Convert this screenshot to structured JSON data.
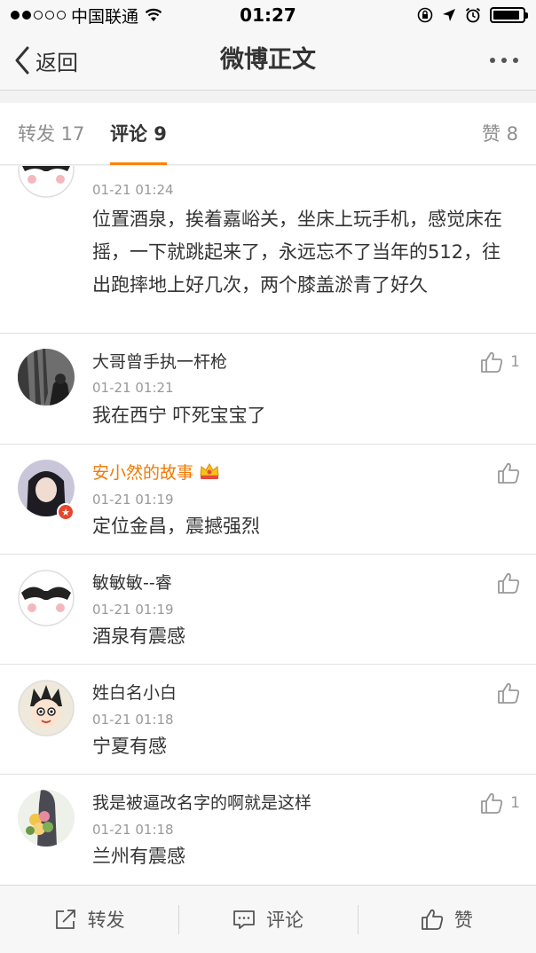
{
  "status_bar": {
    "carrier": "中国联通",
    "time": "01:27",
    "signal_filled": 2,
    "signal_total": 5,
    "battery_level": 0.9
  },
  "navbar": {
    "back_label": "返回",
    "title": "微博正文"
  },
  "tabs": {
    "repost": "转发 17",
    "comment": "评论 9",
    "like": "赞 8",
    "active": "comment",
    "accent": "#ff8200"
  },
  "comments": [
    {
      "name": "",
      "time": "01-21 01:24",
      "text": "位置酒泉，挨着嘉峪关，坐床上玩手机，感觉床在摇，一下就跳起来了，永远忘不了当年的512，往出跑摔地上好几次，两个膝盖淤青了好久",
      "likes": "",
      "avatar": "masked-face"
    },
    {
      "name": "大哥曾手执一杆枪",
      "time": "01-21 01:21",
      "text": "我在西宁 吓死宝宝了",
      "likes": "1",
      "avatar": "dark-photo"
    },
    {
      "name": "安小然的故事",
      "time": "01-21 01:19",
      "text": "定位金昌，震撼强烈",
      "likes": "",
      "avatar": "girl-photo",
      "vip": true,
      "verified": true
    },
    {
      "name": "敏敏敏--睿",
      "time": "01-21 01:19",
      "text": "酒泉有震感",
      "likes": "",
      "avatar": "masked-face"
    },
    {
      "name": "姓白名小白",
      "time": "01-21 01:18",
      "text": "宁夏有感",
      "likes": "",
      "avatar": "cartoon-boy"
    },
    {
      "name": "我是被逼改名字的啊就是这样",
      "time": "01-21 01:18",
      "text": "兰州有震感",
      "likes": "1",
      "avatar": "flowers-photo"
    }
  ],
  "toolbar": {
    "repost": "转发",
    "comment": "评论",
    "like": "赞"
  },
  "colors": {
    "vip_name": "#ef7a06",
    "time_gray": "#999999",
    "verified_badge": "#e8452c"
  }
}
